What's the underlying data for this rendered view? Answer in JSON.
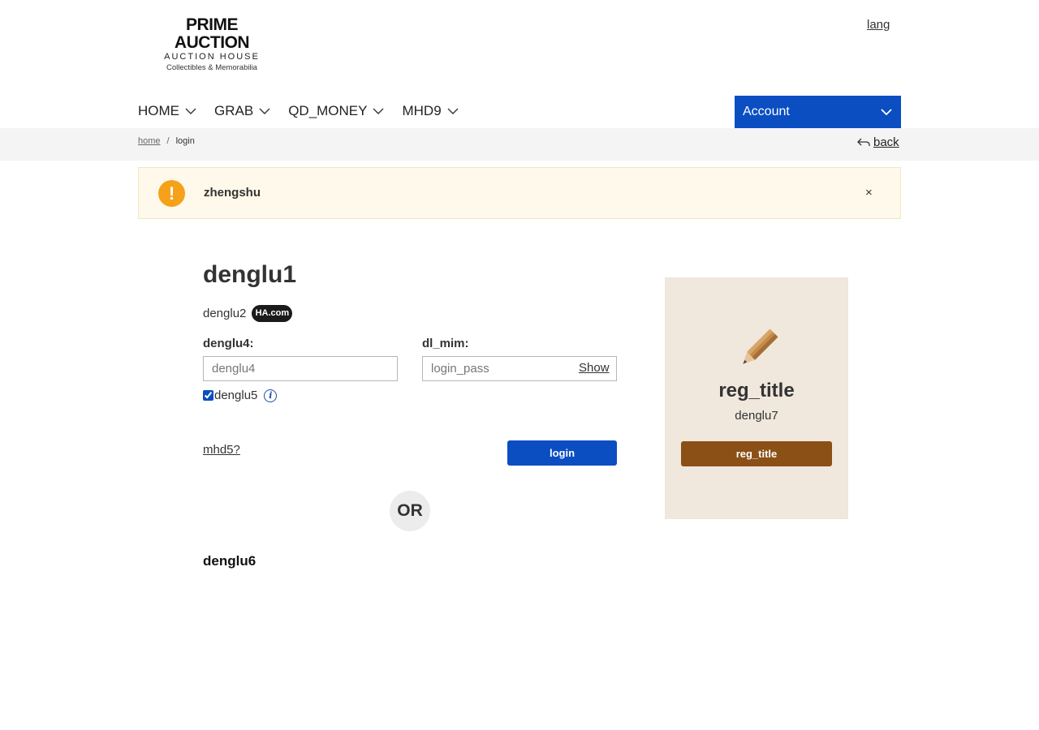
{
  "header": {
    "logo_main": "PRIME AUCTION",
    "logo_sub": "AUCTION HOUSE",
    "logo_tagline": "Collectibles & Memorabilia",
    "lang_link": "lang"
  },
  "nav": {
    "items": [
      {
        "label": "HOME"
      },
      {
        "label": "GRAB"
      },
      {
        "label": "QD_MONEY"
      },
      {
        "label": "MHD9"
      }
    ],
    "account_label": "Account",
    "brand_color": "#0a4ec2"
  },
  "breadcrumb": {
    "home": "home",
    "separator": "/",
    "current": "login",
    "back_label": "back"
  },
  "alert": {
    "icon": "!",
    "message": "zhengshu",
    "close": "×"
  },
  "login": {
    "title": "denglu1",
    "subtitle": "denglu2",
    "badge": "HA.com",
    "username_label": "denglu4:",
    "username_placeholder": "denglu4",
    "username_value": "",
    "password_label": "dl_mim:",
    "password_placeholder": "login_pass",
    "password_value": "",
    "show_label": "Show",
    "remember_label": "denglu5",
    "remember_checked": true,
    "forgot_label": "mhd5? ",
    "submit_label": "login",
    "or_label": "OR",
    "alt_heading": "denglu6"
  },
  "register": {
    "title": "reg_title",
    "subtitle": "denglu7",
    "button_label": "reg_title",
    "icon": "pencil-icon",
    "card_color": "#f0e7dd",
    "button_color": "#8a5015"
  }
}
